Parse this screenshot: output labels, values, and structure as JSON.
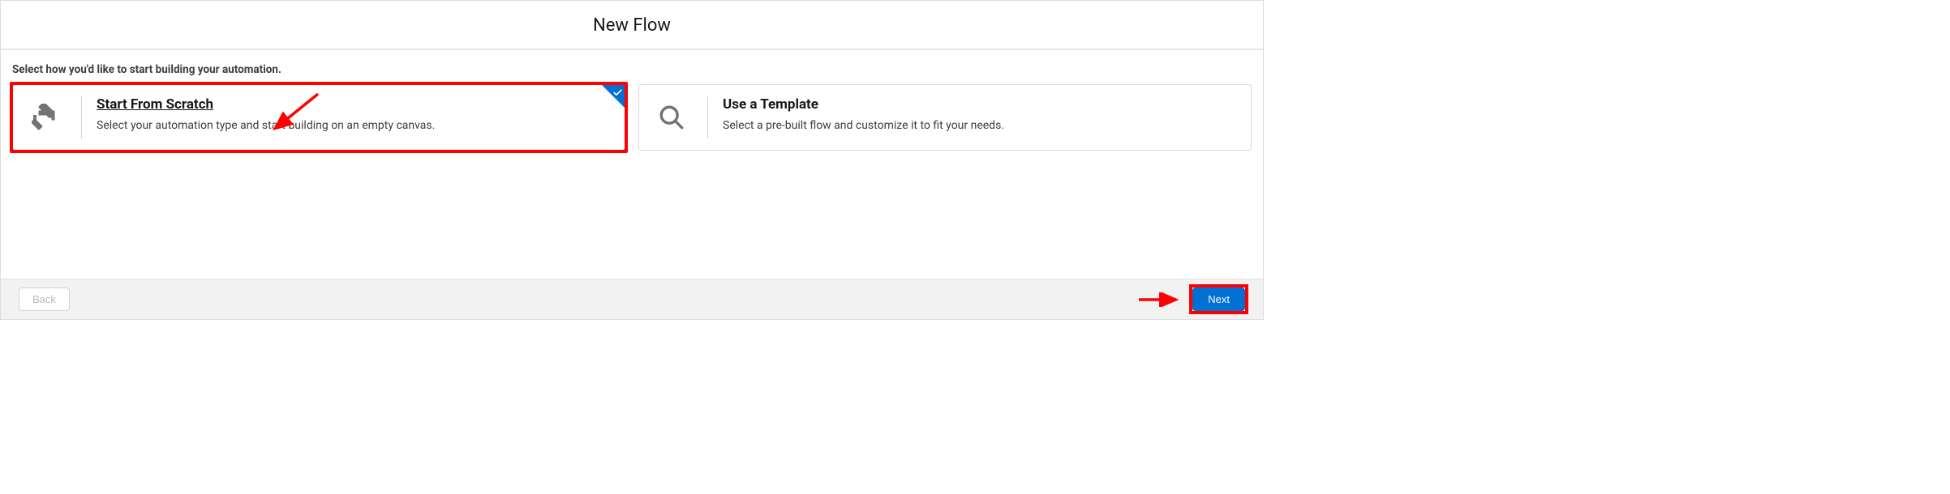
{
  "header": {
    "title": "New Flow"
  },
  "body": {
    "prompt": "Select how you'd like to start building your automation."
  },
  "options": [
    {
      "title": "Start From Scratch",
      "desc": "Select your automation type and start building on an empty canvas.",
      "selected": true
    },
    {
      "title": "Use a Template",
      "desc": "Select a pre-built flow and customize it to fit your needs.",
      "selected": false
    }
  ],
  "footer": {
    "back_label": "Back",
    "next_label": "Next"
  }
}
